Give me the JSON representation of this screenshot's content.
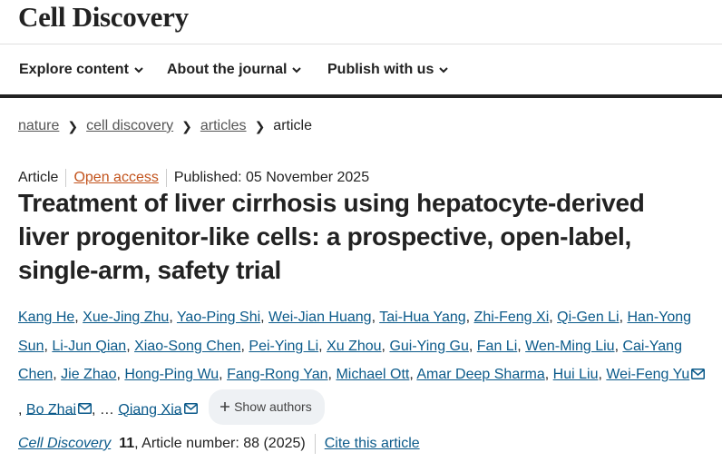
{
  "header": {
    "journal_title": "Cell Discovery"
  },
  "nav": {
    "items": [
      {
        "label": "Explore content"
      },
      {
        "label": "About the journal"
      },
      {
        "label": "Publish with us"
      }
    ]
  },
  "breadcrumb": {
    "items": [
      "nature",
      "cell discovery",
      "articles"
    ],
    "current": "article"
  },
  "article": {
    "type": "Article",
    "access": "Open access",
    "published": "Published: 05 November 2025",
    "title": "Treatment of liver cirrhosis using hepatocyte-derived liver progenitor-like cells: a prospective, open-label, single-arm, safety trial",
    "authors": [
      "Kang He",
      "Xue-Jing Zhu",
      "Yao-Ping Shi",
      "Wei-Jian Huang",
      "Tai-Hua Yang",
      "Zhi-Feng Xi",
      "Qi-Gen Li",
      "Han-Yong Sun",
      "Li-Jun Qian",
      "Xiao-Song Chen",
      "Pei-Ying Li",
      "Xu Zhou",
      "Gui-Ying Gu",
      "Fan Li",
      "Wen-Ming Liu",
      "Cai-Yang Chen",
      "Jie Zhao",
      "Hong-Ping Wu",
      "Fang-Rong Yan",
      "Michael Ott",
      "Amar Deep Sharma",
      "Hui Liu",
      "Wei-Feng Yu",
      "Bo Zhai",
      "Qiang Xia"
    ],
    "ellipsis": "…",
    "show_authors_label": "Show authors",
    "journal": "Cell Discovery",
    "volume": "11",
    "article_number": ", Article number: 88 (2025)",
    "cite_label": "Cite this article"
  },
  "icons": {
    "chevron": "chevron-down-icon",
    "mail": "mail-icon",
    "plus": "plus-icon"
  }
}
